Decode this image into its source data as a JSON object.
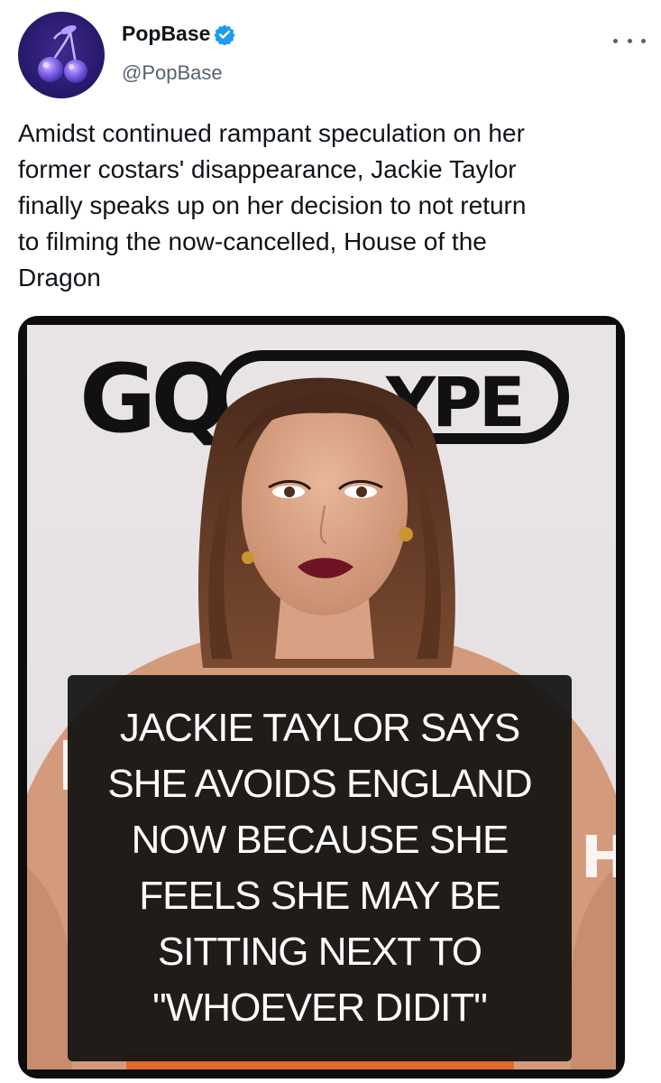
{
  "author": {
    "display_name": "PopBase",
    "handle": "@PopBase",
    "verified": true,
    "avatar_icon": "cherry-icon"
  },
  "more_icon": "more-options-icon",
  "tweet": {
    "text": "Amidst continued rampant speculation on her\nformer costars' disappearance, Jackie Taylor\nfinally speaks up on her decision to not return\nto filming the now-cancelled, House of the\nDragon"
  },
  "media": {
    "magazine_logo": "GQ",
    "magazine_logo_partial": "YPE",
    "side_letter": "H",
    "caption_lines": [
      "JACKIE TAYLOR SAYS",
      "SHE AVOIDS ENGLAND",
      "NOW BECAUSE SHE",
      "FEELS SHE MAY BE",
      "SITTING NEXT TO",
      "\"WHOEVER DIDIT\""
    ]
  },
  "colors": {
    "verified_blue": "#1d9bf0",
    "avatar_bg": "#2a1a6e",
    "text_primary": "#0f1419",
    "text_secondary": "#536471"
  }
}
